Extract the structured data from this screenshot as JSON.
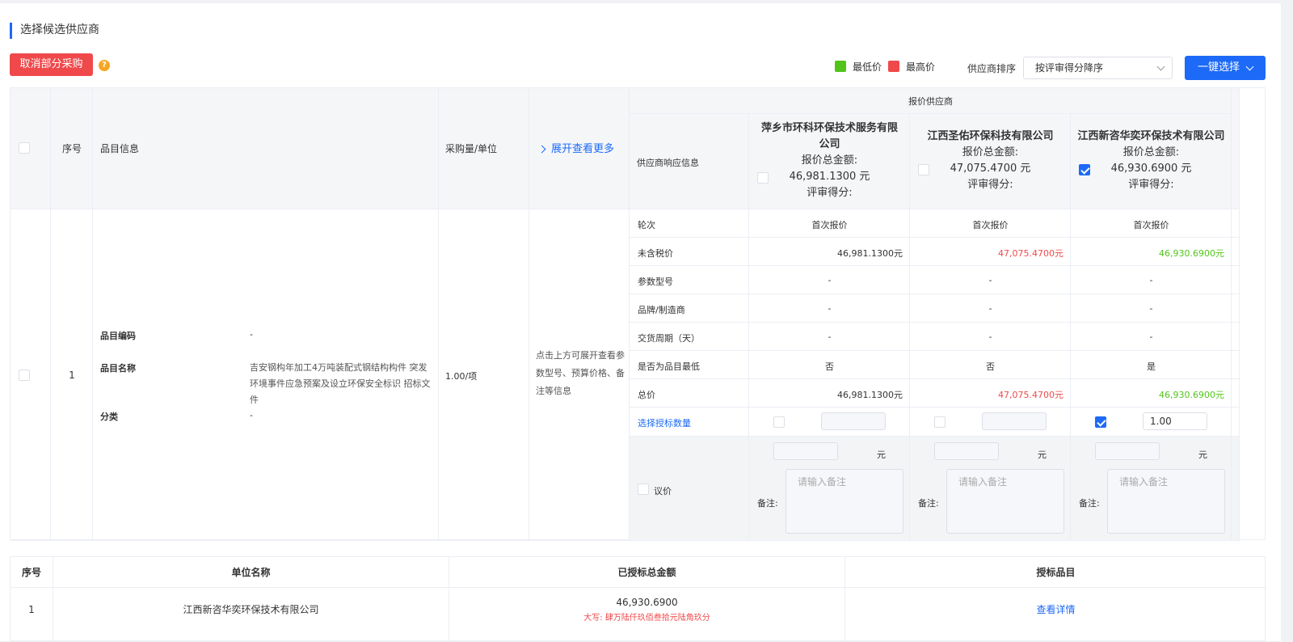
{
  "section_title": "选择候选供应商",
  "toolbar": {
    "cancel_label": "取消部分采购",
    "help_icon": "?",
    "legend_low": "最低价",
    "legend_high": "最高价",
    "legend_low_color": "#52c41a",
    "legend_high_color": "#f0494b",
    "sort_label": "供应商排序",
    "sort_value": "按评审得分降序",
    "one_click_label": "一键选择"
  },
  "table": {
    "headers": {
      "seq": "序号",
      "item_info": "品目信息",
      "qty_unit": "采购量/单位",
      "expand": "展开查看更多",
      "vendors_group": "报价供应商",
      "vendor_response": "供应商响应信息"
    },
    "vendors": [
      {
        "name": "萍乡市环科环保技术服务有限公司",
        "total_label": "报价总金额:",
        "total": "46,981.1300 元",
        "score_label": "评审得分:",
        "checked": false
      },
      {
        "name": "江西圣佑环保科技有限公司",
        "total_label": "报价总金额:",
        "total": "47,075.4700 元",
        "score_label": "评审得分:",
        "checked": false
      },
      {
        "name": "江西新咨华奕环保技术有限公司",
        "total_label": "报价总金额:",
        "total": "46,930.6900 元",
        "score_label": "评审得分:",
        "checked": true
      }
    ],
    "row": {
      "seq": "1",
      "code_label": "品目编码",
      "code_value": "-",
      "name_label": "品目名称",
      "name_value": "吉安钢构年加工4万吨装配式钢结构构件 突发环境事件应急预案及设立环保安全标识 招标文件",
      "category_label": "分类",
      "category_value": "-",
      "qty": "1.00/项",
      "expand_hint": "点击上方可展开查看参数型号、预算价格、备注等信息"
    },
    "attr_rows": [
      {
        "label": "轮次",
        "values": [
          "首次报价",
          "首次报价",
          "首次报价"
        ]
      },
      {
        "label": "未含税价",
        "values": [
          "46,981.1300元",
          "47,075.4700元",
          "46,930.6900元"
        ]
      },
      {
        "label": "参数型号",
        "values": [
          "-",
          "-",
          "-"
        ]
      },
      {
        "label": "品牌/制造商",
        "values": [
          "-",
          "-",
          "-"
        ]
      },
      {
        "label": "交货周期（天）",
        "values": [
          "-",
          "-",
          "-"
        ]
      },
      {
        "label": "是否为品目最低",
        "values": [
          "否",
          "否",
          "是"
        ]
      },
      {
        "label": "总价",
        "values": [
          "46,981.1300元",
          "47,075.4700元",
          "46,930.6900元"
        ]
      }
    ],
    "award_qty_label": "选择授标数量",
    "award_qty_value": "1.00",
    "negotiate_label": "议价",
    "yuan": "元",
    "remark_label": "备注:",
    "remark_placeholder": "请输入备注"
  },
  "summary": {
    "headers": [
      "序号",
      "单位名称",
      "已授标总金额",
      "授标品目"
    ],
    "rows": [
      {
        "seq": "1",
        "company": "江西新咨华奕环保技术有限公司",
        "amount": "46,930.6900",
        "amount_caps": "大写:   肆万陆仟玖佰叁拾元陆角玖分",
        "detail_link": "查看详情"
      }
    ]
  }
}
